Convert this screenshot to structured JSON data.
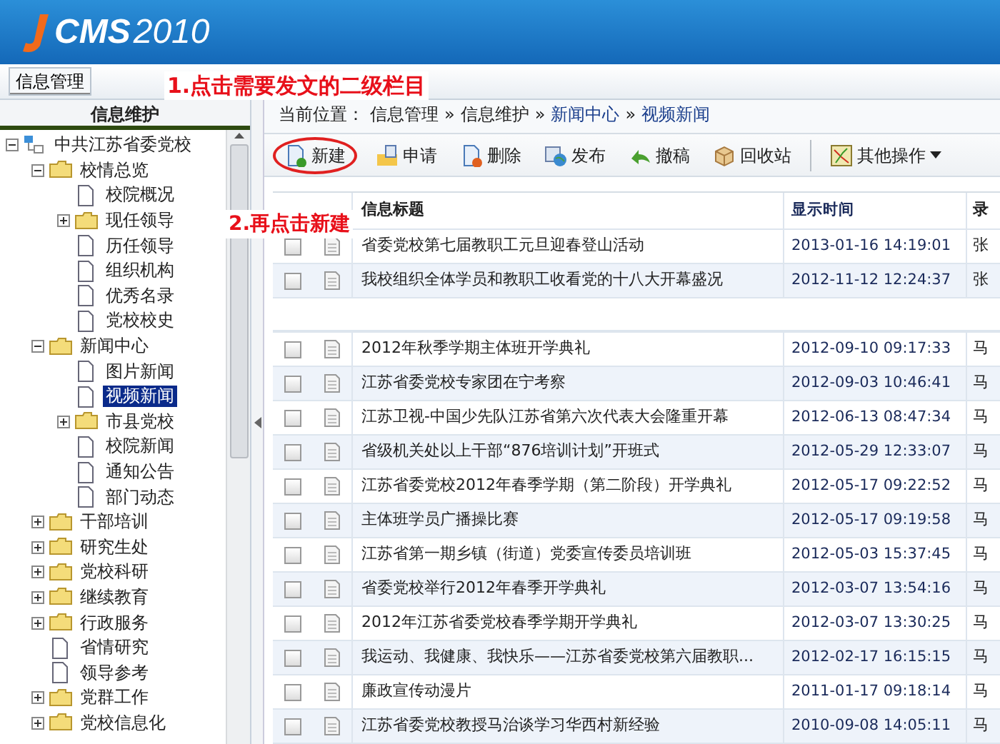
{
  "header": {
    "logo_text": "CMS",
    "logo_year": "2010"
  },
  "menu": [
    {
      "label": "信息管理",
      "selected": true
    }
  ],
  "annotations": [
    "1.点击需要发文的二级栏目",
    "2.再点击新建"
  ],
  "sidebar": {
    "title": "信息维护",
    "tree": [
      {
        "label": "中共江苏省委党校",
        "kind": "root",
        "expanded": true,
        "selected": false,
        "children": [
          {
            "label": "校情总览",
            "kind": "folder",
            "expanded": true,
            "selected": false,
            "children": [
              {
                "label": "校院概况",
                "kind": "page",
                "selected": false
              },
              {
                "label": "现任领导",
                "kind": "folder",
                "expanded": false,
                "selected": false
              },
              {
                "label": "历任领导",
                "kind": "page",
                "selected": false
              },
              {
                "label": "组织机构",
                "kind": "page",
                "selected": false
              },
              {
                "label": "优秀名录",
                "kind": "page",
                "selected": false
              },
              {
                "label": "党校校史",
                "kind": "page",
                "selected": false
              }
            ]
          },
          {
            "label": "新闻中心",
            "kind": "folder",
            "expanded": true,
            "selected": false,
            "children": [
              {
                "label": "图片新闻",
                "kind": "page",
                "selected": false
              },
              {
                "label": "视频新闻",
                "kind": "page",
                "selected": true
              },
              {
                "label": "市县党校",
                "kind": "folder",
                "expanded": false,
                "selected": false
              },
              {
                "label": "校院新闻",
                "kind": "page",
                "selected": false
              },
              {
                "label": "通知公告",
                "kind": "page",
                "selected": false
              },
              {
                "label": "部门动态",
                "kind": "page",
                "selected": false
              }
            ]
          },
          {
            "label": "干部培训",
            "kind": "folder",
            "expanded": false,
            "selected": false
          },
          {
            "label": "研究生处",
            "kind": "folder",
            "expanded": false,
            "selected": false
          },
          {
            "label": "党校科研",
            "kind": "folder",
            "expanded": false,
            "selected": false
          },
          {
            "label": "继续教育",
            "kind": "folder",
            "expanded": false,
            "selected": false
          },
          {
            "label": "行政服务",
            "kind": "folder",
            "expanded": false,
            "selected": false
          },
          {
            "label": "省情研究",
            "kind": "page",
            "selected": false
          },
          {
            "label": "领导参考",
            "kind": "page",
            "selected": false
          },
          {
            "label": "党群工作",
            "kind": "folder",
            "expanded": false,
            "selected": false
          },
          {
            "label": "党校信息化",
            "kind": "folder",
            "expanded": false,
            "selected": false
          }
        ]
      }
    ]
  },
  "breadcrumb": [
    {
      "label": "当前位置：",
      "kind": "text"
    },
    {
      "label": "信息管理",
      "kind": "text"
    },
    {
      "label": "»",
      "kind": "sep"
    },
    {
      "label": "信息维护",
      "kind": "text"
    },
    {
      "label": "»",
      "kind": "sep"
    },
    {
      "label": "新闻中心",
      "kind": "link"
    },
    {
      "label": "»",
      "kind": "sep"
    },
    {
      "label": "视频新闻",
      "kind": "link"
    }
  ],
  "toolbar": [
    {
      "label": "新建",
      "kind": "new",
      "circled": true
    },
    {
      "label": "申请",
      "kind": "apply",
      "circled": false
    },
    {
      "label": "删除",
      "kind": "delete",
      "circled": false
    },
    {
      "label": "发布",
      "kind": "publish",
      "circled": false
    },
    {
      "label": "撤稿",
      "kind": "withdraw",
      "circled": false
    },
    {
      "label": "回收站",
      "kind": "recycle",
      "circled": false
    },
    {
      "label": "其他操作",
      "kind": "more",
      "circled": false
    }
  ],
  "table": {
    "columns": [
      "信息标题",
      "显示时间",
      "录"
    ],
    "rows": [
      {
        "kind": "row",
        "checked": false,
        "title": "省委党校第七届教职工元旦迎春登山活动",
        "time": "2013-01-16 14:19:01",
        "column_3": "张"
      },
      {
        "kind": "row",
        "checked": false,
        "title": "我校组织全体学员和教职工收看党的十八大开幕盛况",
        "time": "2012-11-12 12:24:37",
        "column_3": "张"
      },
      {
        "kind": "blank"
      },
      {
        "kind": "row",
        "checked": false,
        "title": "2012年秋季学期主体班开学典礼",
        "time": "2012-09-10 09:17:33",
        "column_3": "马"
      },
      {
        "kind": "row",
        "checked": false,
        "title": "江苏省委党校专家团在宁考察",
        "time": "2012-09-03 10:46:41",
        "column_3": "马"
      },
      {
        "kind": "row",
        "checked": false,
        "title": "江苏卫视-中国少先队江苏省第六次代表大会隆重开幕",
        "time": "2012-06-13 08:47:34",
        "column_3": "马"
      },
      {
        "kind": "row",
        "checked": false,
        "title": "省级机关处以上干部“876培训计划”开班式",
        "time": "2012-05-29 12:33:07",
        "column_3": "马"
      },
      {
        "kind": "row",
        "checked": false,
        "title": "江苏省委党校2012年春季学期（第二阶段）开学典礼",
        "time": "2012-05-17 09:22:52",
        "column_3": "马"
      },
      {
        "kind": "row",
        "checked": false,
        "title": "主体班学员广播操比赛",
        "time": "2012-05-17 09:19:58",
        "column_3": "马"
      },
      {
        "kind": "row",
        "checked": false,
        "title": "江苏省第一期乡镇（街道）党委宣传委员培训班",
        "time": "2012-05-03 15:37:45",
        "column_3": "马"
      },
      {
        "kind": "row",
        "checked": false,
        "title": "省委党校举行2012年春季开学典礼",
        "time": "2012-03-07 13:54:16",
        "column_3": "马"
      },
      {
        "kind": "row",
        "checked": false,
        "title": "2012年江苏省委党校春季学期开学典礼",
        "time": "2012-03-07 13:30:25",
        "column_3": "马"
      },
      {
        "kind": "row",
        "checked": false,
        "title": "我运动、我健康、我快乐——江苏省委党校第六届教职...",
        "time": "2012-02-17 16:15:15",
        "column_3": "马"
      },
      {
        "kind": "row",
        "checked": false,
        "title": "廉政宣传动漫片",
        "time": "2011-01-17 09:18:14",
        "column_3": "马"
      },
      {
        "kind": "row",
        "checked": false,
        "title": "江苏省委党校教授马治谈学习华西村新经验",
        "time": "2010-09-08 14:05:11",
        "column_3": "马"
      }
    ]
  }
}
